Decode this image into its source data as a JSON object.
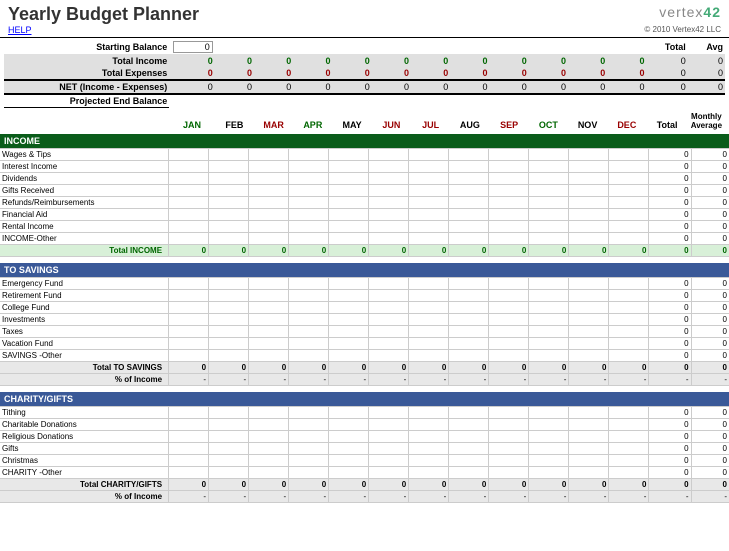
{
  "header": {
    "title": "Yearly Budget Planner",
    "logo_text": "vertex",
    "logo_num": "42",
    "help": "HELP",
    "copyright": "© 2010 Vertex42 LLC"
  },
  "summary": {
    "starting_balance_label": "Starting Balance",
    "starting_balance_value": "0",
    "total_income_label": "Total Income",
    "total_expenses_label": "Total Expenses",
    "net_label": "NET (Income - Expenses)",
    "projected_label": "Projected End Balance",
    "total_header": "Total",
    "avg_header": "Avg",
    "monthly_header1": "Monthly",
    "monthly_header2": "Average",
    "total_header2": "Total"
  },
  "months": [
    "JAN",
    "FEB",
    "MAR",
    "APR",
    "MAY",
    "JUN",
    "JUL",
    "AUG",
    "SEP",
    "OCT",
    "NOV",
    "DEC"
  ],
  "month_colors": [
    "green",
    "",
    "red",
    "green",
    "",
    "red",
    "red",
    "",
    "red",
    "green",
    "",
    "red"
  ],
  "zeros": [
    "0",
    "0",
    "0",
    "0",
    "0",
    "0",
    "0",
    "0",
    "0",
    "0",
    "0",
    "0"
  ],
  "zero": "0",
  "dash": "-",
  "sections": {
    "income": {
      "title": "INCOME",
      "rows": [
        "Wages & Tips",
        "Interest Income",
        "Dividends",
        "Gifts Received",
        "Refunds/Reimbursements",
        "Financial Aid",
        "Rental Income",
        "INCOME-Other"
      ],
      "total_label": "Total INCOME"
    },
    "savings": {
      "title": "TO SAVINGS",
      "rows": [
        "Emergency Fund",
        "Retirement Fund",
        "College Fund",
        "Investments",
        "Taxes",
        "Vacation Fund",
        "SAVINGS -Other"
      ],
      "total_label": "Total TO SAVINGS",
      "pct_label": "% of Income"
    },
    "charity": {
      "title": "CHARITY/GIFTS",
      "rows": [
        "Tithing",
        "Charitable Donations",
        "Religious Donations",
        "Gifts",
        "Christmas",
        "CHARITY -Other"
      ],
      "total_label": "Total CHARITY/GIFTS",
      "pct_label": "% of Income"
    }
  }
}
